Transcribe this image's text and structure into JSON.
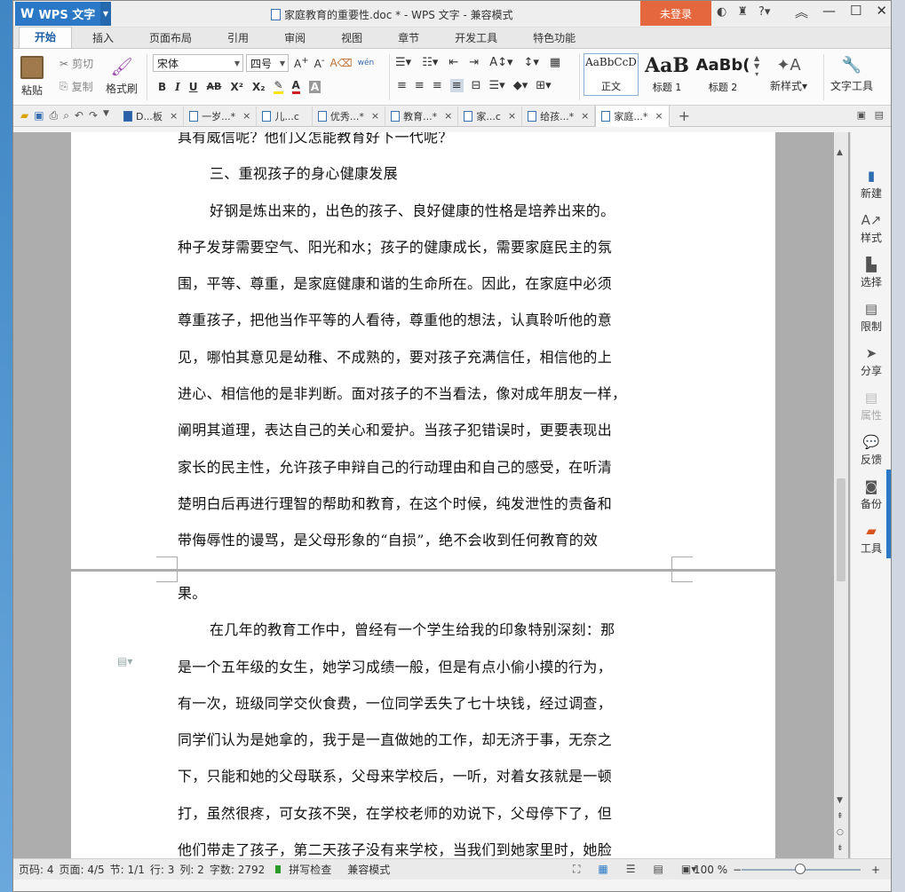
{
  "app": {
    "name": "WPS 文字",
    "logo": "W",
    "window_title": "家庭教育的重要性.doc * - WPS 文字 - 兼容模式",
    "login_label": "未登录"
  },
  "menu_tabs": [
    "开始",
    "插入",
    "页面布局",
    "引用",
    "审阅",
    "视图",
    "章节",
    "开发工具",
    "特色功能"
  ],
  "ribbon": {
    "paste": "粘贴",
    "cut": "剪切",
    "copy": "复制",
    "format_painter": "格式刷",
    "font_name": "宋体",
    "font_size": "四号",
    "bold": "B",
    "italic": "I",
    "underline": "U",
    "strike": "AB",
    "superscript": "X²",
    "subscript": "X₂",
    "styles": [
      {
        "preview": "AaBbCcD",
        "label": "正文"
      },
      {
        "preview": "AaB",
        "label": "标题 1"
      },
      {
        "preview": "AaBb(",
        "label": "标题 2"
      }
    ],
    "new_style": "新样式",
    "text_tools": "文字工具",
    "ime_label": "wén"
  },
  "doc_tabs": [
    {
      "label": "D...板",
      "close": "×"
    },
    {
      "label": "一岁...*",
      "close": "×"
    },
    {
      "label": "儿...c",
      "close": ""
    },
    {
      "label": "优秀...*",
      "close": "×"
    },
    {
      "label": "教育...*",
      "close": "×"
    },
    {
      "label": "家...c",
      "close": "×"
    },
    {
      "label": "给孩...*",
      "close": "×"
    },
    {
      "label": "家庭...*",
      "close": "×",
      "active": true
    }
  ],
  "document": {
    "page1_lines": [
      "具有威信呢？他们又怎能教育好下一代呢？",
      "三、重视孩子的身心健康发展",
      "好钢是炼出来的，出色的孩子、良好健康的性格是培养出来的。",
      "种子发芽需要空气、阳光和水；孩子的健康成长，需要家庭民主的氛",
      "围，平等、尊重，是家庭健康和谐的生命所在。因此，在家庭中必须",
      "尊重孩子，把他当作平等的人看待，尊重他的想法，认真聆听他的意",
      "见，哪怕其意见是幼稚、不成熟的，要对孩子充满信任，相信他的上",
      "进心、相信他的是非判断。面对孩子的不当看法，像对成年朋友一样，",
      "阐明其道理，表达自己的关心和爱护。当孩子犯错误时，更要表现出",
      "家长的民主性，允许孩子申辩自己的行动理由和自己的感受，在听清",
      "楚明白后再进行理智的帮助和教育，在这个时候，纯发泄性的责备和",
      "带侮辱性的谩骂，是父母形象的“自损”，绝不会收到任何教育的效"
    ],
    "page2_lines": [
      "果。",
      "在几年的教育工作中，曾经有一个学生给我的印象特别深刻：那",
      "是一个五年级的女生，她学习成绩一般，但是有点小偷小摸的行为，",
      "有一次，班级同学交伙食费，一位同学丢失了七十块钱，经过调查，",
      "同学们认为是她拿的，我于是一直做她的工作，却无济于事，无奈之",
      "下，只能和她的父母联系，父母来学校后，一听，对着女孩就是一顿",
      "打，虽然很疼，可女孩不哭，在学校老师的劝说下，父母停下了，但",
      "他们带走了孩子，第二天孩子没有来学校，当我们到她家里时，她脸"
    ]
  },
  "right_panel": [
    "新建",
    "样式",
    "选择",
    "限制",
    "分享",
    "属性",
    "反馈",
    "备份",
    "工具"
  ],
  "status": {
    "page_no": "页码: 4",
    "pages": "页面: 4/5",
    "section": "节: 1/1",
    "row": "行: 3",
    "col": "列: 2",
    "word_count": "字数: 2792",
    "spell_check": "拼写检查",
    "compat": "兼容模式",
    "zoom": "100 %"
  },
  "colors": {
    "accent": "#2b78c6",
    "login": "#e5673e"
  }
}
